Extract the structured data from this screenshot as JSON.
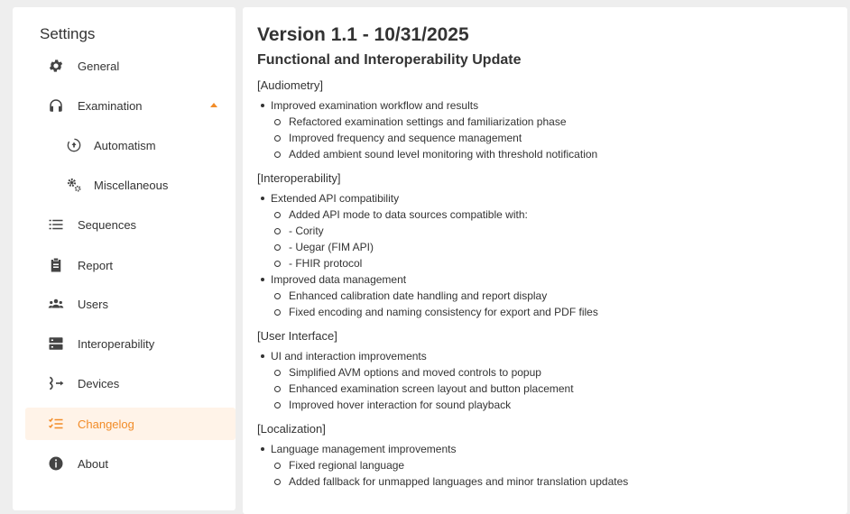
{
  "sidebar": {
    "title": "Settings",
    "items": [
      {
        "label": "General",
        "icon": "gear-icon"
      },
      {
        "label": "Examination",
        "icon": "headphones-icon",
        "expanded": true
      },
      {
        "label": "Automatism",
        "icon": "auto-cycle-icon",
        "sub": true
      },
      {
        "label": "Miscellaneous",
        "icon": "gears-icon",
        "sub": true
      },
      {
        "label": "Sequences",
        "icon": "list-icon"
      },
      {
        "label": "Report",
        "icon": "clipboard-icon"
      },
      {
        "label": "Users",
        "icon": "users-icon"
      },
      {
        "label": "Interoperability",
        "icon": "server-icon"
      },
      {
        "label": "Devices",
        "icon": "devices-icon"
      },
      {
        "label": "Changelog",
        "icon": "checklist-icon",
        "active": true
      },
      {
        "label": "About",
        "icon": "info-icon"
      }
    ]
  },
  "colors": {
    "accent": "#f28c28",
    "active_bg": "#fff3e8",
    "background": "#eeeeee"
  },
  "changelog": {
    "version_title": "Version 1.1 - 10/31/2025",
    "version_subtitle": "Functional and Interoperability Update",
    "sections": [
      {
        "title": "[Audiometry]",
        "items": [
          {
            "text": "Improved examination workflow and results",
            "children": [
              "Refactored examination settings and familiarization phase",
              "Improved frequency and sequence management",
              "Added ambient sound level monitoring with threshold notification"
            ]
          }
        ]
      },
      {
        "title": "[Interoperability]",
        "items": [
          {
            "text": "Extended API compatibility",
            "children": [
              "Added API mode to data sources compatible with:",
              "- Cority",
              "- Uegar (FIM API)",
              "- FHIR protocol"
            ]
          },
          {
            "text": "Improved data management",
            "children": [
              "Enhanced calibration date handling and report display",
              "Fixed encoding and naming consistency for export and PDF files"
            ]
          }
        ]
      },
      {
        "title": "[User Interface]",
        "items": [
          {
            "text": "UI and interaction improvements",
            "children": [
              "Simplified AVM options and moved controls to popup",
              "Enhanced examination screen layout and button placement",
              "Improved hover interaction for sound playback"
            ]
          }
        ]
      },
      {
        "title": "[Localization]",
        "items": [
          {
            "text": "Language management improvements",
            "children": [
              "Fixed regional language",
              "Added fallback for unmapped languages and minor translation updates"
            ]
          }
        ]
      }
    ]
  }
}
